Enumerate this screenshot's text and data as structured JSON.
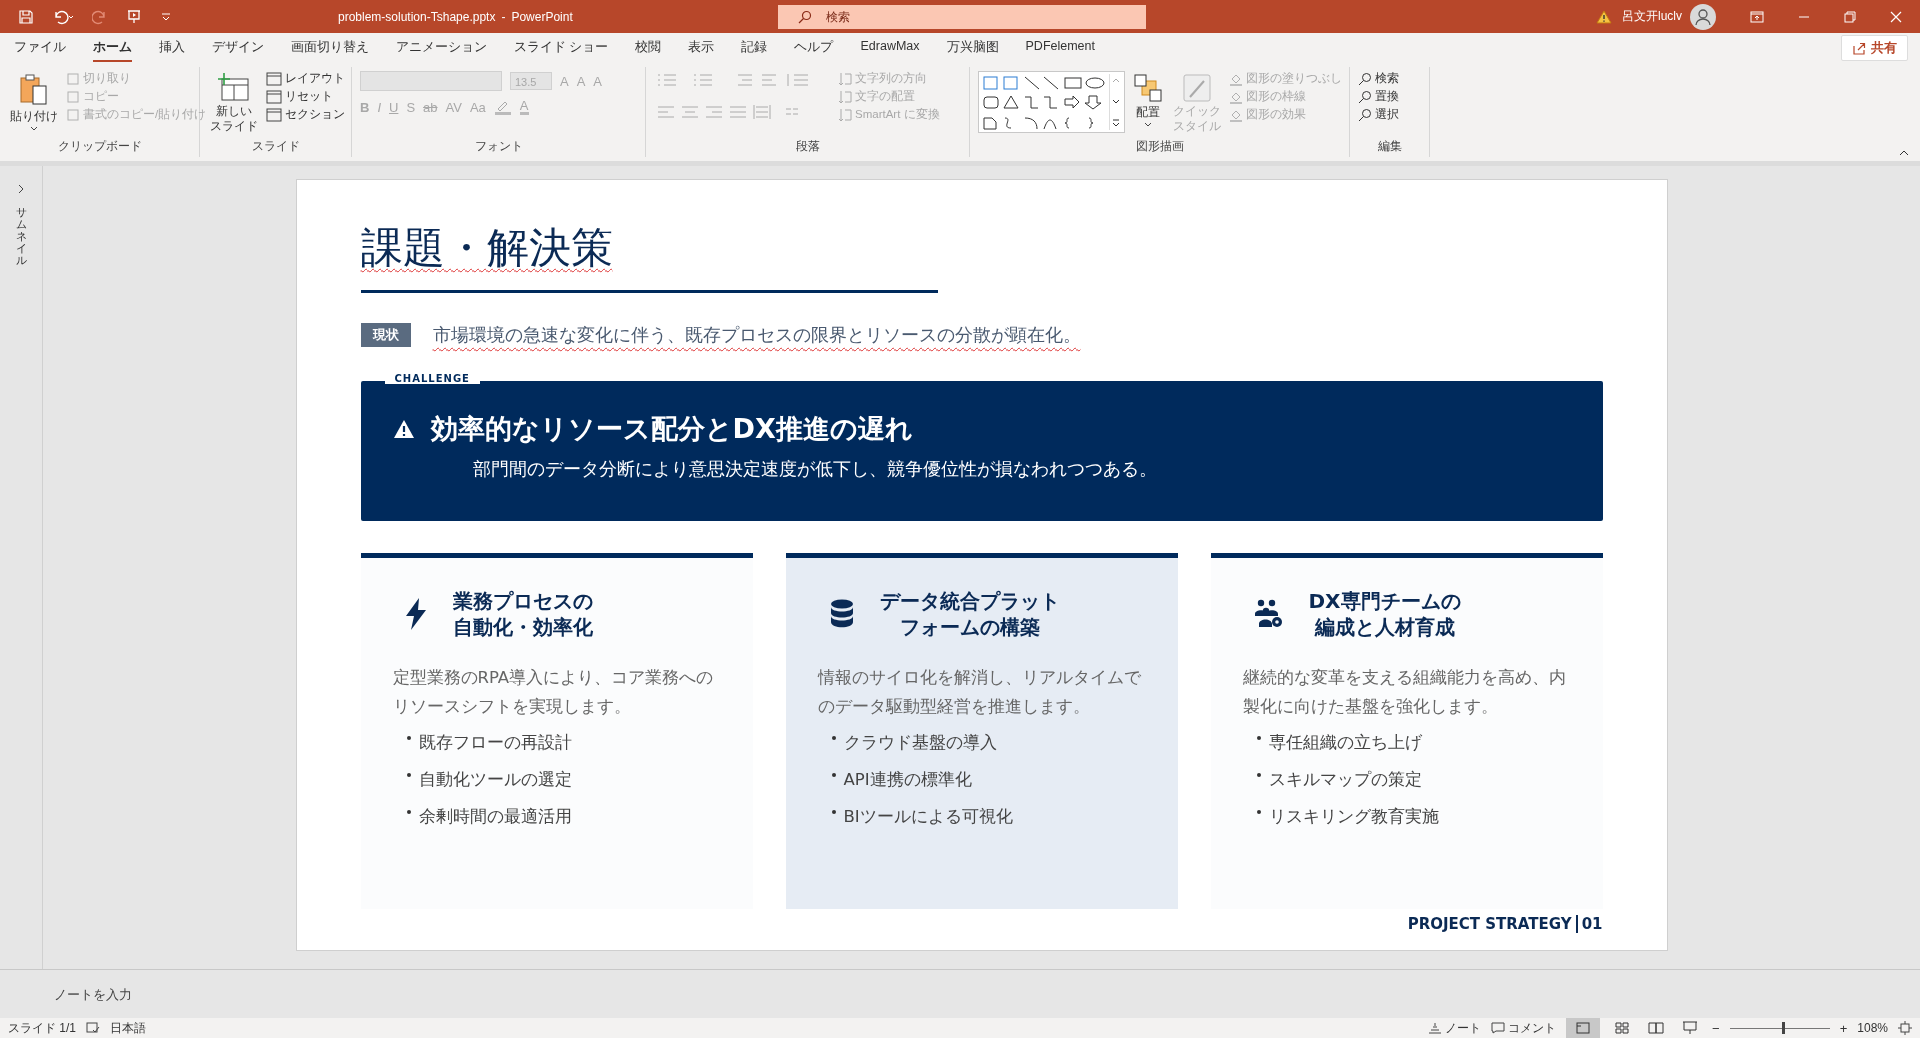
{
  "title_bar": {
    "filename": "problem-solution-Tshape.pptx",
    "separator": "-",
    "app": "PowerPoint",
    "search": {
      "placeholder": "検索"
    },
    "user": "呂文开luclv"
  },
  "menu_tabs": [
    {
      "label": "ファイル",
      "selected": false
    },
    {
      "label": "ホーム",
      "selected": true
    },
    {
      "label": "挿入",
      "selected": false
    },
    {
      "label": "デザイン",
      "selected": false
    },
    {
      "label": "画面切り替え",
      "selected": false
    },
    {
      "label": "アニメーション",
      "selected": false
    },
    {
      "label": "スライド ショー",
      "selected": false
    },
    {
      "label": "校閲",
      "selected": false
    },
    {
      "label": "表示",
      "selected": false
    },
    {
      "label": "記録",
      "selected": false
    },
    {
      "label": "ヘルプ",
      "selected": false
    },
    {
      "label": "EdrawMax",
      "selected": false
    },
    {
      "label": "万兴脑图",
      "selected": false
    },
    {
      "label": "PDFelement",
      "selected": false
    }
  ],
  "share_button": "共有",
  "ribbon": {
    "clipboard": {
      "label": "クリップボード",
      "paste": "貼り付け",
      "items": [
        {
          "label": "切り取り",
          "disabled": true
        },
        {
          "label": "コピー",
          "disabled": true
        },
        {
          "label": "書式のコピー/貼り付け",
          "disabled": true
        }
      ]
    },
    "slides": {
      "label": "スライド",
      "new_slide": [
        "新しい",
        "スライド"
      ],
      "items": [
        {
          "label": "レイアウト"
        },
        {
          "label": "リセット"
        },
        {
          "label": "セクション"
        }
      ]
    },
    "font": {
      "label": "フォント",
      "disabled": true,
      "font_size": "13.5",
      "top_buttons": [
        "A",
        "A",
        "A"
      ],
      "format_buttons": [
        "B",
        "I",
        "U",
        "S",
        "ab",
        "AV",
        "Aa"
      ],
      "color_buttons": [
        "A"
      ]
    },
    "paragraph": {
      "label": "段落",
      "disabled": true,
      "items": [
        "文字列の方向",
        "文字の配置",
        "SmartArt に変換"
      ]
    },
    "drawing": {
      "label": "図形描画",
      "arrange": "配置",
      "quick_style": {
        "label": [
          "クイック",
          "スタイル"
        ],
        "disabled": true
      },
      "items": [
        {
          "label": "図形の塗りつぶし",
          "disabled": true
        },
        {
          "label": "図形の枠線",
          "disabled": true
        },
        {
          "label": "図形の効果",
          "disabled": true
        }
      ]
    },
    "editing": {
      "label": "編集",
      "items": [
        "検索",
        "置換",
        "選択"
      ]
    }
  },
  "thumbnail_pane": {
    "label": "サムネイル"
  },
  "slide": {
    "title": "課題・解決策",
    "current": {
      "tag": "現状",
      "text": "市場環境の急速な変化に伴う、既存プロセスの限界とリソースの分散が顕在化。"
    },
    "challenge": {
      "tag": "CHALLENGE",
      "title": "効率的なリソース配分とDX推進の遅れ",
      "text": "部門間のデータ分断により意思決定速度が低下し、競争優位性が損なわれつつある。"
    },
    "cards": [
      {
        "kind": "bolt",
        "highlighted": false,
        "heading": [
          "業務プロセスの",
          "自動化・効率化"
        ],
        "text": "定型業務のRPA導入により、コア業務へのリソースシフトを実現します。",
        "bullets": [
          "既存フローの再設計",
          "自動化ツールの選定",
          "余剰時間の最適活用"
        ]
      },
      {
        "kind": "database",
        "highlighted": true,
        "heading": [
          "データ統合プラット",
          "フォームの構築"
        ],
        "text": "情報のサイロ化を解消し、リアルタイムでのデータ駆動型経営を推進します。",
        "bullets": [
          "クラウド基盤の導入",
          "API連携の標準化",
          "BIツールによる可視化"
        ]
      },
      {
        "kind": "team",
        "highlighted": false,
        "heading": [
          "DX専門チームの",
          "編成と人材育成"
        ],
        "text": "継続的な変革を支える組織能力を高め、内製化に向けた基盤を強化します。",
        "bullets": [
          "専任組織の立ち上げ",
          "スキルマップの策定",
          "リスキリング教育実施"
        ]
      }
    ],
    "footer": {
      "label": "PROJECT STRATEGY",
      "page": "01"
    }
  },
  "notes": {
    "placeholder": "ノートを入力"
  },
  "status_bar": {
    "slide": "スライド 1/1",
    "language": "日本語",
    "notes_button": "ノート",
    "comments_button": "コメント",
    "zoom": {
      "out": "−",
      "in": "+",
      "level": 0.52,
      "reading": "108%"
    }
  }
}
